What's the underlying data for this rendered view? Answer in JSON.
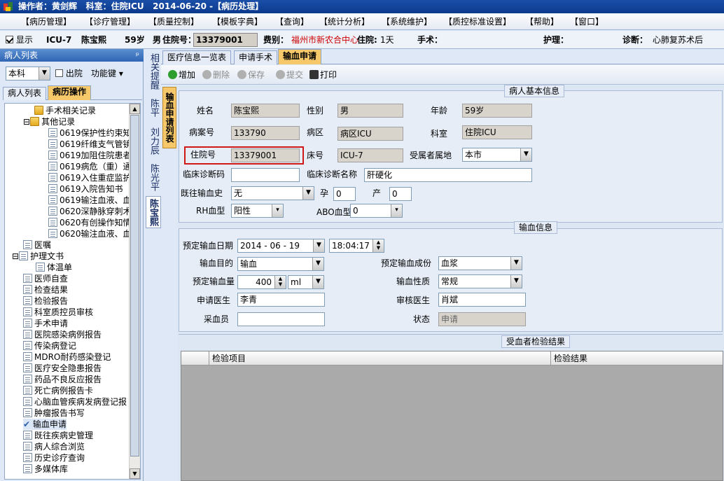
{
  "title": {
    "operator_label": "操作者：",
    "operator": "黄剑辉",
    "dept_label": "科室：",
    "dept": "住院ICU",
    "date": "2014-06-20",
    "module": "-【病历处理】"
  },
  "menu": [
    "【病历管理】",
    "【诊疗管理】",
    "【质量控制】",
    "【模板字典】",
    "【查询】",
    "【统计分析】",
    "【系统维护】",
    "【质控标准设置】",
    "【帮助】",
    "【窗口】"
  ],
  "info": {
    "show_label": "显示",
    "bed": "ICU-7",
    "name": "陈宝熙",
    "age": "59岁",
    "gender": "男",
    "inpatient_label": "住院号：",
    "inpatient_no": "13379001",
    "fee_label": "费别：",
    "fee": "福州市新农合中心",
    "stay_label": "住院:",
    "stay": "1天",
    "surgery_label": "手术：",
    "nursing_label": "护理：",
    "diagnosis_label": "诊断：",
    "diagnosis": "心肺复苏术后"
  },
  "left": {
    "header": "病人列表",
    "pin": "ᵖ",
    "dept": "本科",
    "discharged": "出院",
    "func_label": "功能键",
    "tabs": [
      "病人列表",
      "病历操作"
    ],
    "tree": [
      "手术相关记录",
      "其他记录",
      "0619保护性约束知",
      "0619纤维支气管镜",
      "0619加阻住院患者",
      "0619病危（重）通",
      "0619入住重症监护",
      "0619入院告知书",
      "0619输注血液、血",
      "0620深静脉穿刺术",
      "0620有创操作知情",
      "0620输注血液、血",
      "医嘱",
      "护理文书",
      "体温单",
      "医师自查",
      "检查结果",
      "检验报告",
      "科室质控员审核",
      "手术申请",
      "医院感染病例报告",
      "传染病登记",
      "MDRO耐药感染登记",
      "医疗安全隐患报告",
      "药品不良反应报告",
      "死亡病例报告卡",
      "心脑血管疾病发病登记报",
      "肿瘤报告书写",
      "输血申请",
      "既往疾病史管理",
      "病人综合浏览",
      "历史诊疗查询",
      "多媒体库"
    ]
  },
  "vtabs": [
    "相关提醒",
    "陈平",
    "刘力辰",
    "陈光平",
    "陈宝熙"
  ],
  "main_tabs": [
    "医疗信息一览表",
    "申请手术",
    "输血申请"
  ],
  "toolbar": {
    "add": "增加",
    "delete": "删除",
    "save": "保存",
    "submit": "提交",
    "print": "打印"
  },
  "vlist": "输血申请列表",
  "patient": {
    "section": "病人基本信息",
    "name_label": "姓名",
    "name": "陈宝熙",
    "sex_label": "性别",
    "sex": "男",
    "age_label": "年龄",
    "age": "59岁",
    "record_label": "病案号",
    "record": "133790",
    "ward_label": "病区",
    "ward": "病区ICU",
    "dept_label": "科室",
    "dept": "住院ICU",
    "inp_label": "住院号",
    "inp": "13379001",
    "bed_label": "床号",
    "bed": "ICU-7",
    "region_label": "受属者属地",
    "region": "本市",
    "dx_code_label": "临床诊断码",
    "dx_code": "",
    "dx_name_label": "临床诊断名称",
    "dx_name": "肝硬化",
    "hist_label": "既往输血史",
    "hist": "无",
    "preg_label": "孕",
    "preg": "0",
    "birth_label": "产",
    "birth": "0",
    "rh_label": "RH血型",
    "rh": "阳性",
    "abo_label": "ABO血型",
    "abo": "0"
  },
  "transfusion": {
    "section": "输血信息",
    "date_label": "预定输血日期",
    "date": "2014 - 06 - 19",
    "time": "18:04:17",
    "purpose_label": "输血目的",
    "purpose": "输血",
    "component_label": "预定输血成份",
    "component": "血浆",
    "amount_label": "预定输血量",
    "amount": "400",
    "unit": "ml",
    "nature_label": "输血性质",
    "nature": "常规",
    "doctor_label": "申请医生",
    "doctor": "李青",
    "reviewer_label": "审核医生",
    "reviewer": "肖斌",
    "collector_label": "采血员",
    "collector": "",
    "status_label": "状态",
    "status": "申请"
  },
  "results": {
    "section": "受血者检验结果",
    "col1": "检验项目",
    "col2": "检验结果"
  }
}
